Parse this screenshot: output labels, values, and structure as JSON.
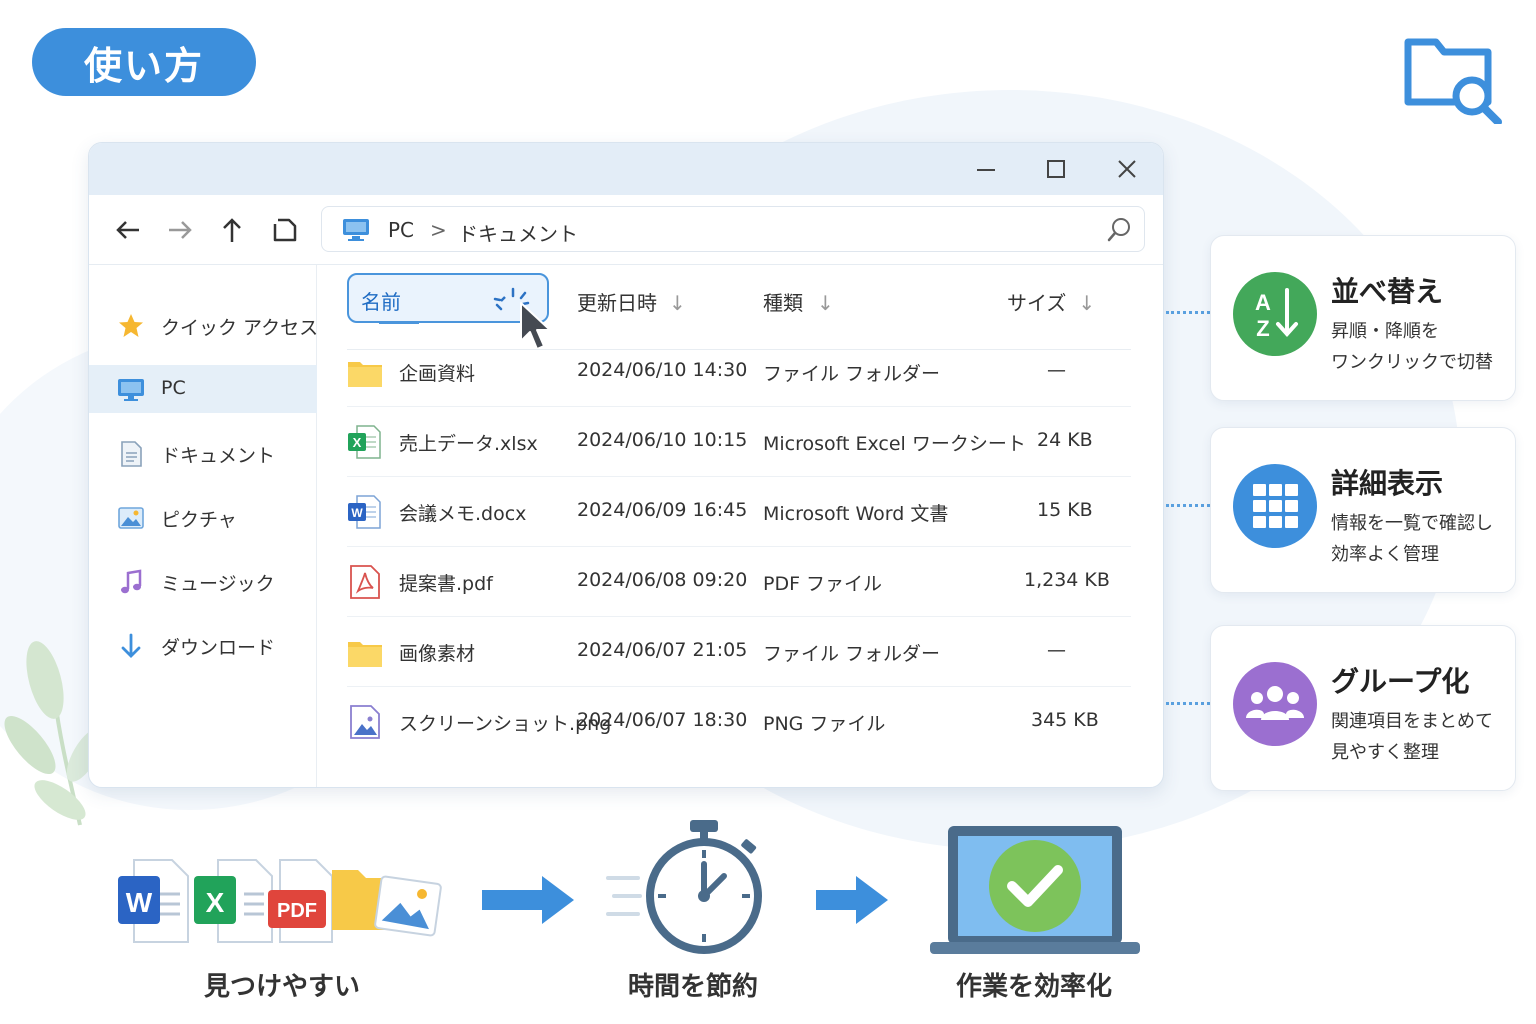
{
  "page": {
    "title": "使い方"
  },
  "window": {
    "breadcrumb": [
      "PC",
      "ドキュメント"
    ],
    "columns": {
      "name": "名前",
      "modified": "更新日時",
      "type": "種類",
      "size": "サイズ"
    },
    "sidebar": [
      {
        "label": "クイック アクセス",
        "icon": "star-icon"
      },
      {
        "label": "PC",
        "icon": "monitor-icon",
        "active": true
      },
      {
        "label": "ドキュメント",
        "icon": "document-icon"
      },
      {
        "label": "ピクチャ",
        "icon": "picture-icon"
      },
      {
        "label": "ミュージック",
        "icon": "music-icon"
      },
      {
        "label": "ダウンロード",
        "icon": "download-icon"
      }
    ],
    "files": [
      {
        "name": "企画資料",
        "date": "2024/06/10 14:30",
        "type": "ファイル フォルダー",
        "size": "—",
        "icon": "folder-icon"
      },
      {
        "name": "売上データ.xlsx",
        "date": "2024/06/10 10:15",
        "type": "Microsoft Excel ワークシート",
        "size": "24 KB",
        "icon": "excel-icon"
      },
      {
        "name": "会議メモ.docx",
        "date": "2024/06/09 16:45",
        "type": "Microsoft Word 文書",
        "size": "15 KB",
        "icon": "word-icon"
      },
      {
        "name": "提案書.pdf",
        "date": "2024/06/08 09:20",
        "type": "PDF ファイル",
        "size": "1,234 KB",
        "icon": "pdf-icon"
      },
      {
        "name": "画像素材",
        "date": "2024/06/07 21:05",
        "type": "ファイル フォルダー",
        "size": "—",
        "icon": "folder-icon"
      },
      {
        "name": "スクリーンショット.png",
        "date": "2024/06/07 18:30",
        "type": "PNG ファイル",
        "size": "345 KB",
        "icon": "image-icon"
      }
    ]
  },
  "features": [
    {
      "title": "並べ替え",
      "desc1": "昇順・降順を",
      "desc2": "ワンクリックで切替",
      "color": "#43a85a",
      "icon": "sort-az-icon"
    },
    {
      "title": "詳細表示",
      "desc1": "情報を一覧で確認し",
      "desc2": "効率よく管理",
      "color": "#3d8fdc",
      "icon": "grid-icon"
    },
    {
      "title": "グループ化",
      "desc1": "関連項目をまとめて",
      "desc2": "見やすく整理",
      "color": "#9b6fd0",
      "icon": "group-icon"
    }
  ],
  "flow": [
    "見つけやすい",
    "時間を節約",
    "作業を効率化"
  ],
  "file_badges": {
    "word": "W",
    "excel": "X",
    "pdf": "PDF"
  }
}
